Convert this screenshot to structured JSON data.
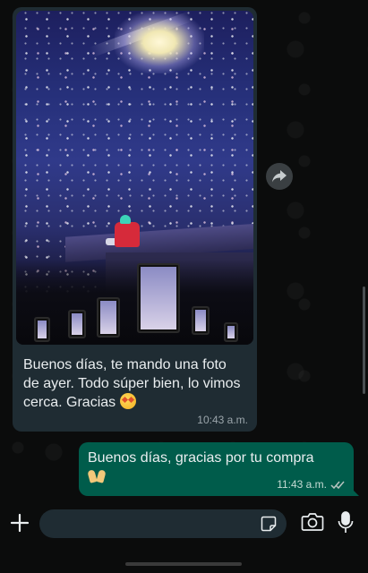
{
  "incoming": {
    "text": "Buenos días, te mando una foto de ayer. Todo súper bien, lo vimos cerca. Gracias",
    "emoji": "star-struck-emoji",
    "time": "10:43 a.m."
  },
  "outgoing": {
    "text": "Buenos días, gracias por tu compra",
    "emoji": "raising-hands-emoji",
    "time": "11:43 a.m.",
    "status": "read"
  },
  "composer": {
    "placeholder": ""
  },
  "icons": {
    "forward": "forward-icon",
    "attach": "plus-icon",
    "sticker": "sticker-icon",
    "camera": "camera-icon",
    "mic": "microphone-icon",
    "read_receipt": "double-check-icon"
  },
  "colors": {
    "background": "#0b0c0c",
    "incoming_bubble": "#1f2c33",
    "outgoing_bubble": "#005c4b",
    "read_check": "#b8c4c0",
    "timestamp": "#9ba5ab"
  }
}
